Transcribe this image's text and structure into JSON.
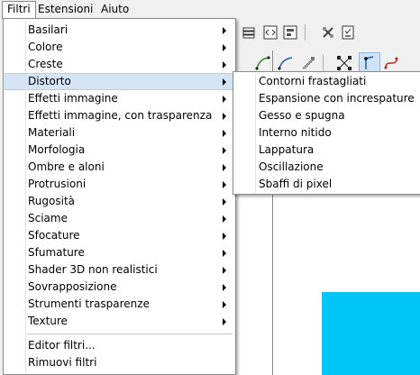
{
  "menubar": {
    "items": [
      "Filtri",
      "Estensioni",
      "Aiuto"
    ]
  },
  "filters_menu": {
    "items": [
      {
        "label": "Basilari",
        "submenu": true
      },
      {
        "label": "Colore",
        "submenu": true
      },
      {
        "label": "Creste",
        "submenu": true
      },
      {
        "label": "Distorto",
        "submenu": true,
        "highlighted": true
      },
      {
        "label": "Effetti immagine",
        "submenu": true
      },
      {
        "label": "Effetti immagine, con trasparenza",
        "submenu": true
      },
      {
        "label": "Materiali",
        "submenu": true
      },
      {
        "label": "Morfologia",
        "submenu": true
      },
      {
        "label": "Ombre e aloni",
        "submenu": true
      },
      {
        "label": "Protrusioni",
        "submenu": true
      },
      {
        "label": "Rugosità",
        "submenu": true
      },
      {
        "label": "Sciame",
        "submenu": true
      },
      {
        "label": "Sfocature",
        "submenu": true
      },
      {
        "label": "Sfumature",
        "submenu": true
      },
      {
        "label": "Shader 3D non realistici",
        "submenu": true
      },
      {
        "label": "Sovrapposizione",
        "submenu": true
      },
      {
        "label": "Strumenti trasparenze",
        "submenu": true
      },
      {
        "label": "Texture",
        "submenu": true
      }
    ],
    "footer_items": [
      "Editor filtri...",
      "Rimuovi filtri"
    ]
  },
  "distort_submenu": {
    "items": [
      "Contorni frastagliati",
      "Espansione con increspature",
      "Gesso e spugna",
      "Interno nitido",
      "Lappatura",
      "Oscillazione",
      "Sbaffi di pixel"
    ]
  },
  "colors": {
    "highlight": "#d6e5f5",
    "canvas_shape": "#00c5f7"
  }
}
